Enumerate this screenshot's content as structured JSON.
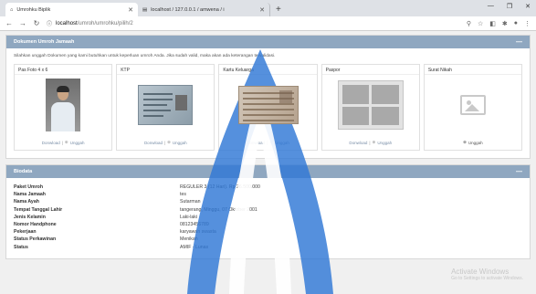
{
  "browser": {
    "tabs": [
      {
        "title": "Umrohku Biplik",
        "active": true
      },
      {
        "title": "localhost / 127.0.0.1 / amwena / i",
        "active": false
      }
    ],
    "new_tab": "+",
    "url_host": "localhost",
    "url_path": "/umroh/umrohku/pilih/2"
  },
  "documents_card": {
    "title": "Dokumen Umroh Jamaah",
    "instruction": "Silahkan unggah Dokumen yang kami butuhkan untuk keperluan umroh Anda. Jika sudah valid, maka akan ada keterangan tervalidasi.",
    "items": [
      {
        "title": "Pas Foto 4 x 6",
        "download": "Donwload",
        "upload": "Unggah"
      },
      {
        "title": "KTP",
        "download": "Donwload",
        "upload": "Unggah"
      },
      {
        "title": "Kartu Keluarga",
        "download": "Donwload",
        "upload": "Unggah"
      },
      {
        "title": "Paspor",
        "download": "Donwload",
        "upload": "Unggah"
      },
      {
        "title": "Surat Nikah",
        "upload": "Unggah"
      }
    ]
  },
  "biodata_card": {
    "title": "Biodata",
    "rows": [
      {
        "label": "Paket Umroh",
        "value": "REGULER 3 (12 Hari). Rp 26.500.000"
      },
      {
        "label": "Nama Jamaah",
        "value": "tes"
      },
      {
        "label": "Nama Ayah",
        "value": "Sutarman"
      },
      {
        "label": "Tempat Tanggal Lahir",
        "value": "tangerang, Minggu, 07 Oktober 2001"
      },
      {
        "label": "Jenis Kelamin",
        "value": "Laki-laki"
      },
      {
        "label": "Nomor Handphone",
        "value": "08123456789"
      },
      {
        "label": "Pekerjaan",
        "value": "karyawan swasta"
      },
      {
        "label": "Status Perkawinan",
        "value": "Menikah"
      },
      {
        "label": "Status",
        "value": "AMIF - Lunas"
      }
    ]
  },
  "watermark": {
    "line1": "Activate Windows",
    "line2": "Go to Settings to activate Windows."
  },
  "colors": {
    "card_header": "#8fa7c0",
    "watermark_blue": "#2f77d6"
  }
}
